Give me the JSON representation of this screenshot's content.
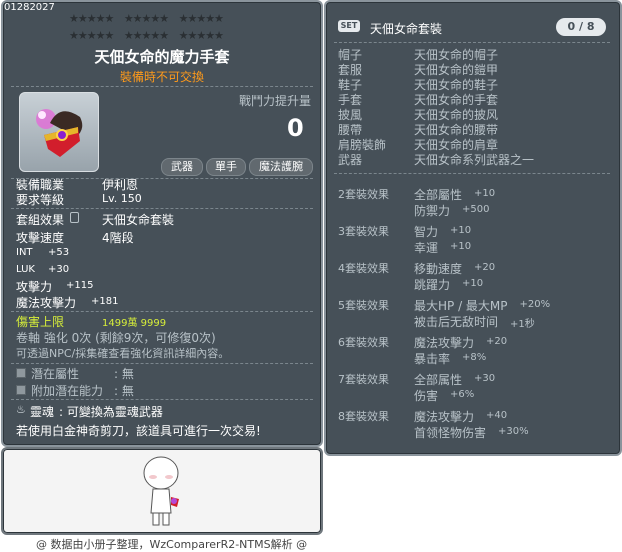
{
  "item_id": "01282027",
  "star_rows": [
    [
      "★★★★★",
      "★★★★★",
      "★★★★★"
    ],
    [
      "★★★★★",
      "★★★★★",
      "★★★★★"
    ]
  ],
  "item": {
    "name": "天佃女命的魔力手套",
    "notice": "裝備時不可交換",
    "power_label": "戰鬥力提升量",
    "power_value": "0",
    "tags": [
      "武器",
      "單手",
      "魔法護腕"
    ]
  },
  "requirements": [
    {
      "label": "裝備職業",
      "value": "伊利恩"
    },
    {
      "label": "要求等級",
      "value": "Lv. 150"
    }
  ],
  "set_info": {
    "label": "套組效果",
    "value": "天佃女命套裝"
  },
  "attack_speed": {
    "label": "攻擊速度",
    "value": "4階段"
  },
  "stats": [
    {
      "label": "INT",
      "value": "+53"
    },
    {
      "label": "LUK",
      "value": "+30"
    },
    {
      "label": "攻擊力",
      "value": "+115"
    },
    {
      "label": "魔法攻擊力",
      "value": "+181"
    }
  ],
  "damage_cap": {
    "label": "傷害上限",
    "value": "1499萬 9999"
  },
  "scroll": {
    "line": "卷軸 強化 0次 (剩餘9次，可修復0次)",
    "note": "可透過NPC/採集確查看強化資訊詳細內容。"
  },
  "potential": [
    {
      "label": "潛在屬性",
      "value": ": 無"
    },
    {
      "label": "附加潛在能力",
      "value": ": 無"
    }
  ],
  "soul": {
    "label": "靈魂",
    "value": ": 可變換為靈魂武器"
  },
  "trade_note": "若使用白金神奇剪刀，該道具可進行一次交易!",
  "set_panel": {
    "badge": "SET",
    "title": "天佃女命套裝",
    "count": "0 / 8",
    "pieces": [
      {
        "slot": "帽子",
        "name": "天佃女命的帽子"
      },
      {
        "slot": "套服",
        "name": "天佃女命的鎧甲"
      },
      {
        "slot": "鞋子",
        "name": "天佃女命的鞋子"
      },
      {
        "slot": "手套",
        "name": "天佃女命的手套"
      },
      {
        "slot": "披風",
        "name": "天佃女命的披风"
      },
      {
        "slot": "腰帶",
        "name": "天佃女命的腰带"
      },
      {
        "slot": "肩膀裝飾",
        "name": "天佃女命的肩章"
      },
      {
        "slot": "武器",
        "name": "天佃女命系列武器之一"
      }
    ],
    "effects": [
      {
        "set": "2套裝效果",
        "lines": [
          {
            "stat": "全部屬性",
            "val": "+10"
          },
          {
            "stat": "防禦力",
            "val": "+500"
          }
        ]
      },
      {
        "set": "3套裝效果",
        "lines": [
          {
            "stat": "智力",
            "val": "+10"
          },
          {
            "stat": "幸運",
            "val": "+10"
          }
        ]
      },
      {
        "set": "4套裝效果",
        "lines": [
          {
            "stat": "移動速度",
            "val": "+20"
          },
          {
            "stat": "跳躍力",
            "val": "+10"
          }
        ]
      },
      {
        "set": "5套裝效果",
        "lines": [
          {
            "stat": "最大HP / 最大MP",
            "val": "+20%"
          },
          {
            "stat": "被击后无敌时间",
            "val": "+1秒"
          }
        ]
      },
      {
        "set": "6套裝效果",
        "lines": [
          {
            "stat": "魔法攻擊力",
            "val": "+20"
          },
          {
            "stat": "暴击率",
            "val": "+8%"
          }
        ]
      },
      {
        "set": "7套裝效果",
        "lines": [
          {
            "stat": "全部属性",
            "val": "+30"
          },
          {
            "stat": "伤害",
            "val": "+6%"
          }
        ]
      },
      {
        "set": "8套裝效果",
        "lines": [
          {
            "stat": "魔法攻擊力",
            "val": "+40"
          },
          {
            "stat": "首领怪物伤害",
            "val": "+30%"
          }
        ]
      }
    ]
  },
  "footer": "@ 数据由小册子整理，WzComparerR2-NTMS解析 @"
}
